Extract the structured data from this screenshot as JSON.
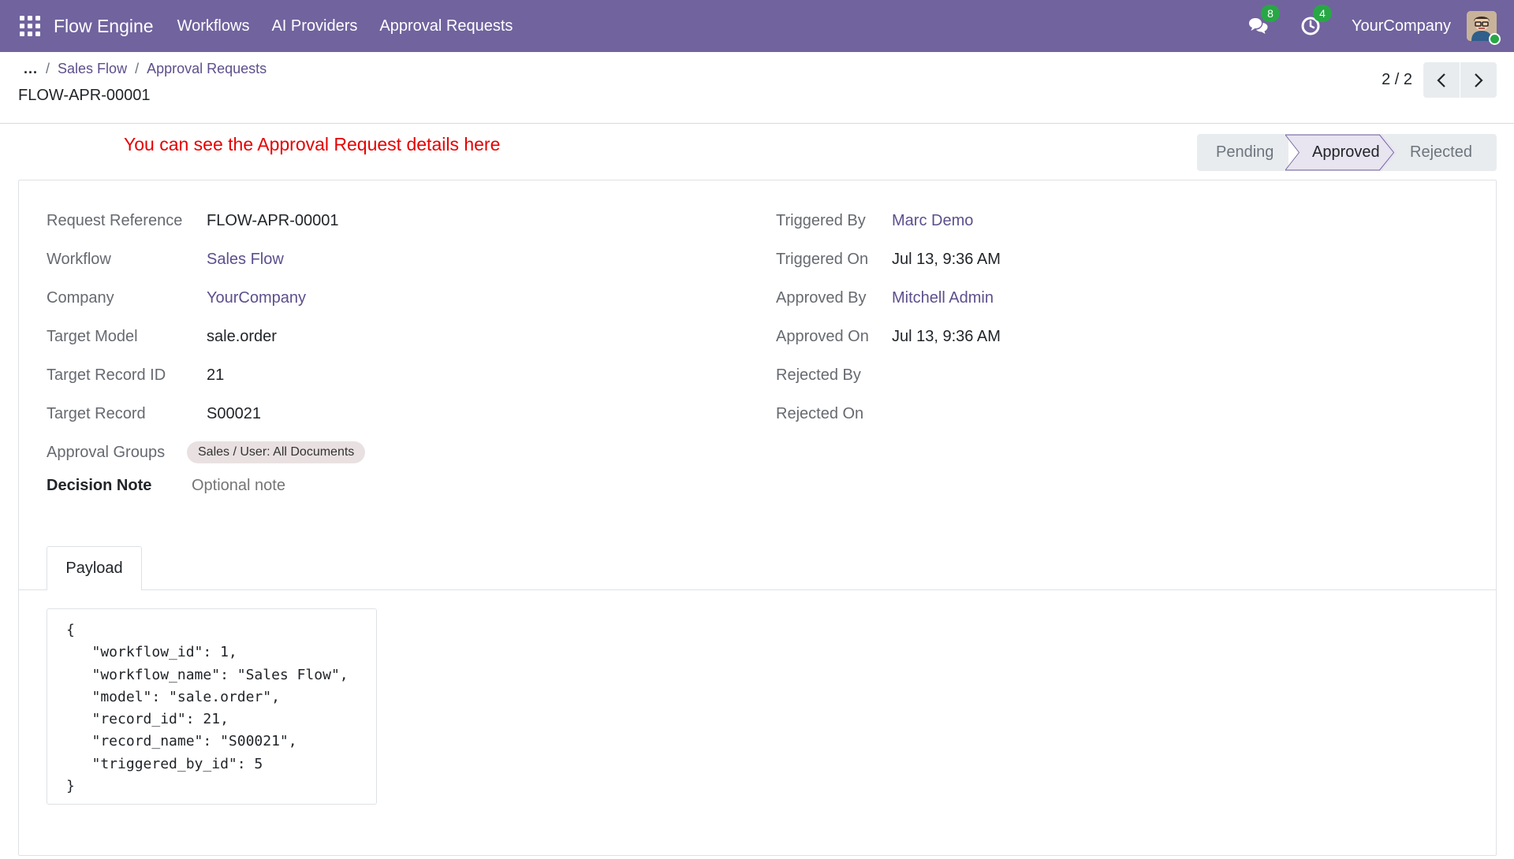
{
  "navbar": {
    "brand": "Flow Engine",
    "menu": [
      "Workflows",
      "AI Providers",
      "Approval Requests"
    ],
    "messages_count": "8",
    "activities_count": "4",
    "company": "YourCompany",
    "bg_color": "#71639e"
  },
  "breadcrumb": {
    "dots": "...",
    "items": [
      "Sales Flow",
      "Approval Requests"
    ],
    "separator": "/"
  },
  "record_title": "FLOW-APR-00001",
  "pager": {
    "value": "2 / 2"
  },
  "annotation": "You can see the Approval Request details here",
  "statusbar": {
    "stages": [
      "Pending",
      "Approved",
      "Rejected"
    ],
    "current": "Approved"
  },
  "left_fields": {
    "request_reference": {
      "label": "Request Reference",
      "value": "FLOW-APR-00001"
    },
    "workflow": {
      "label": "Workflow",
      "value": "Sales Flow"
    },
    "company": {
      "label": "Company",
      "value": "YourCompany"
    },
    "target_model": {
      "label": "Target Model",
      "value": "sale.order"
    },
    "target_record_id": {
      "label": "Target Record ID",
      "value": "21"
    },
    "target_record": {
      "label": "Target Record",
      "value": "S00021"
    },
    "approval_groups": {
      "label": "Approval Groups",
      "tags": [
        "Sales / User: All Documents"
      ]
    },
    "decision_note": {
      "label": "Decision Note",
      "placeholder": "Optional note"
    }
  },
  "right_fields": {
    "triggered_by": {
      "label": "Triggered By",
      "value": "Marc Demo"
    },
    "triggered_on": {
      "label": "Triggered On",
      "value": "Jul 13, 9:36 AM"
    },
    "approved_by": {
      "label": "Approved By",
      "value": "Mitchell Admin"
    },
    "approved_on": {
      "label": "Approved On",
      "value": "Jul 13, 9:36 AM"
    },
    "rejected_by": {
      "label": "Rejected By",
      "value": ""
    },
    "rejected_on": {
      "label": "Rejected On",
      "value": ""
    }
  },
  "tabs": [
    "Payload"
  ],
  "payload": "{\n   \"workflow_id\": 1,\n   \"workflow_name\": \"Sales Flow\",\n   \"model\": \"sale.order\",\n   \"record_id\": 21,\n   \"record_name\": \"S00021\",\n   \"triggered_by_id\": 5\n}",
  "colors": {
    "link": "#5d4f8c",
    "annotation": "#e60000",
    "badge": "#28a745"
  }
}
